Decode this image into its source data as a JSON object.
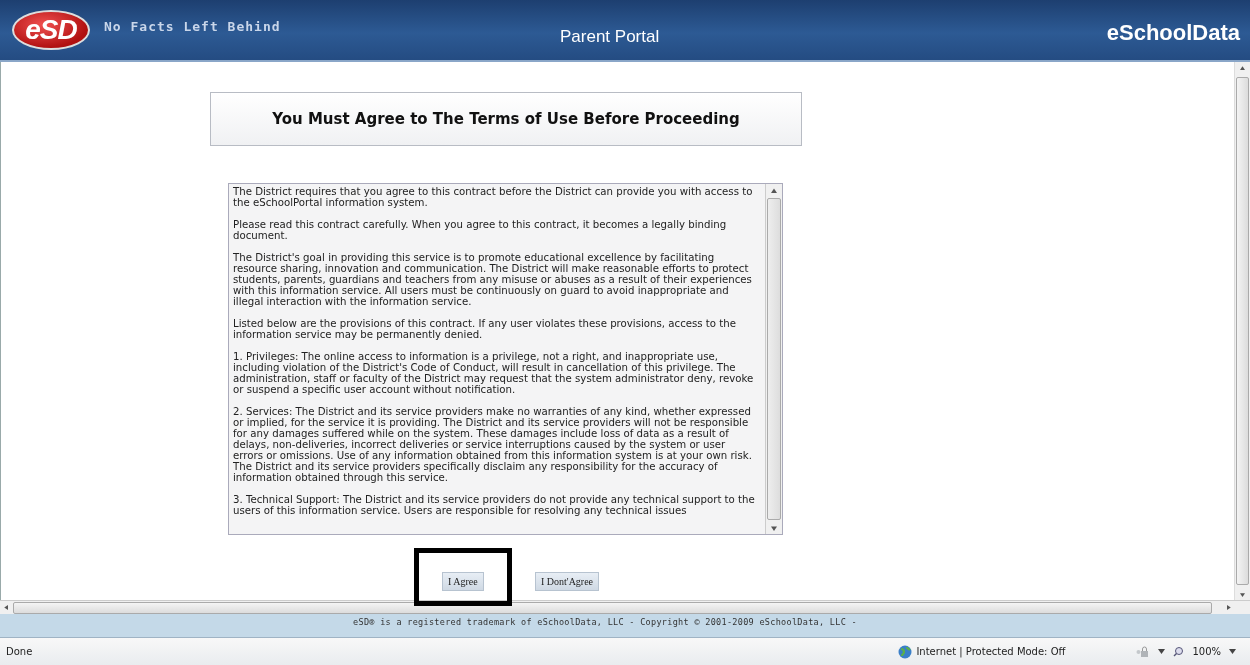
{
  "header": {
    "logo": "eSD",
    "tagline": "No Facts Left Behind",
    "portal": "Parent Portal",
    "brand": "eSchoolData"
  },
  "heading": "You Must Agree to The Terms of Use Before Proceeding",
  "terms": [
    "The District requires that you agree to this contract before the District can provide you with access to the eSchoolPortal information system.",
    "Please read this contract carefully. When you agree to this contract, it becomes a legally binding document.",
    "The District's goal in providing this service is to promote educational excellence by facilitating resource sharing, innovation and communication.  The District will make reasonable efforts to protect students, parents, guardians and teachers from any misuse or abuses as a result of their experiences with this information service.  All users must be continuously on guard to avoid inappropriate and illegal interaction with the information service.",
    "Listed below are the provisions of this contract.  If any user violates these provisions, access to the information service may be permanently denied.",
    "1. Privileges: The online access to information is a privilege, not a right, and inappropriate use, including violation of the District's Code of Conduct, will result in cancellation of this privilege.  The administration, staff or faculty of the District may request that the system administrator deny, revoke or suspend a specific user account without notification.",
    "2. Services: The District and its service providers make no warranties of any kind, whether expressed or implied, for the service it is providing.  The District and its service providers will not be responsible for any damages suffered while on the system. These damages include loss of data as a result of delays, non-deliveries, incorrect deliveries or service interruptions caused by the system or user errors or omissions.  Use of any information obtained from this information system is at your own risk.  The District and its service providers specifically disclaim any responsibility for the accuracy of information obtained through this service.",
    "3. Technical Support: The District and its service providers do not provide any technical support to the users of this information service.  Users are responsible for resolving any technical issues"
  ],
  "buttons": [
    {
      "label": "I Agree",
      "highlighted": true
    },
    {
      "label": "I Dont'Agree",
      "highlighted": false
    }
  ],
  "footer": "eSD® is a registered trademark of eSchoolData, LLC - Copyright © 2001-2009 eSchoolData, LLC -",
  "status_bar": {
    "text": "Done",
    "zone": "Internet | Protected Mode: Off",
    "zoom": "100%"
  }
}
